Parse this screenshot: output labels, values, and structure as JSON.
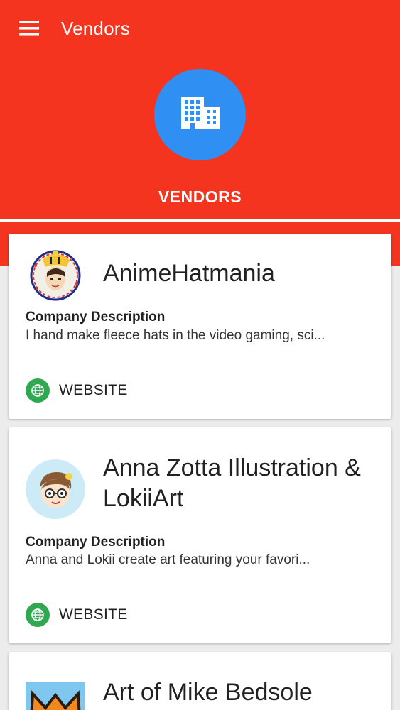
{
  "app": {
    "title": "Vendors",
    "hero_label": "VENDORS",
    "icons": {
      "menu": "hamburger-menu-icon",
      "hero": "building-icon",
      "website": "globe-icon"
    },
    "colors": {
      "header": "#f5341f",
      "hero_circle": "#2f8ff2",
      "website_icon": "#2fa84f"
    }
  },
  "vendors": [
    {
      "name": "AnimeHatmania",
      "description_label": "Company Description",
      "description": "I hand make fleece hats in the video gaming, sci...",
      "website_label": "WEBSITE"
    },
    {
      "name": "Anna Zotta Illustration & LokiiArt",
      "description_label": "Company Description",
      "description": "Anna and Lokii create art featuring your favori...",
      "website_label": "WEBSITE"
    },
    {
      "name": "Art of Mike Bedsole"
    }
  ]
}
